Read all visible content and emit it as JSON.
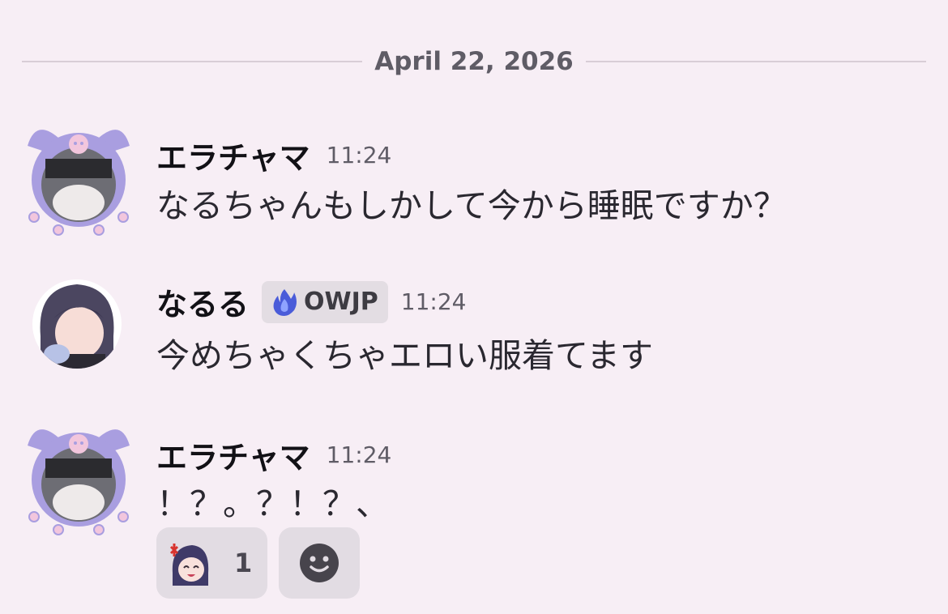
{
  "date_divider": "April 22, 2026",
  "messages": [
    {
      "username": "エラチャマ",
      "time": "11:24",
      "text": "なるちゃんもしかして今から睡眠ですか？",
      "avatar": "cat-kuromi-avatar"
    },
    {
      "username": "なるる",
      "tag": "OWJP",
      "tag_icon": "blue-flame-icon",
      "time": "11:24",
      "text": "今めちゃくちゃエロい服着てます",
      "avatar": "anime-girl-avatar"
    },
    {
      "username": "エラチャマ",
      "time": "11:24",
      "text": "！？。？！？、",
      "avatar": "cat-kuromi-avatar",
      "reactions": [
        {
          "emoji": "angry-anime-girl-emoji",
          "count": "1"
        }
      ],
      "add_reaction_icon": "smiley-face-icon"
    }
  ],
  "colors": {
    "background": "#f7eef5",
    "reaction_bg": "#e2dce3",
    "tag_bg": "#e3dde3",
    "divider": "#d8cdd6"
  }
}
